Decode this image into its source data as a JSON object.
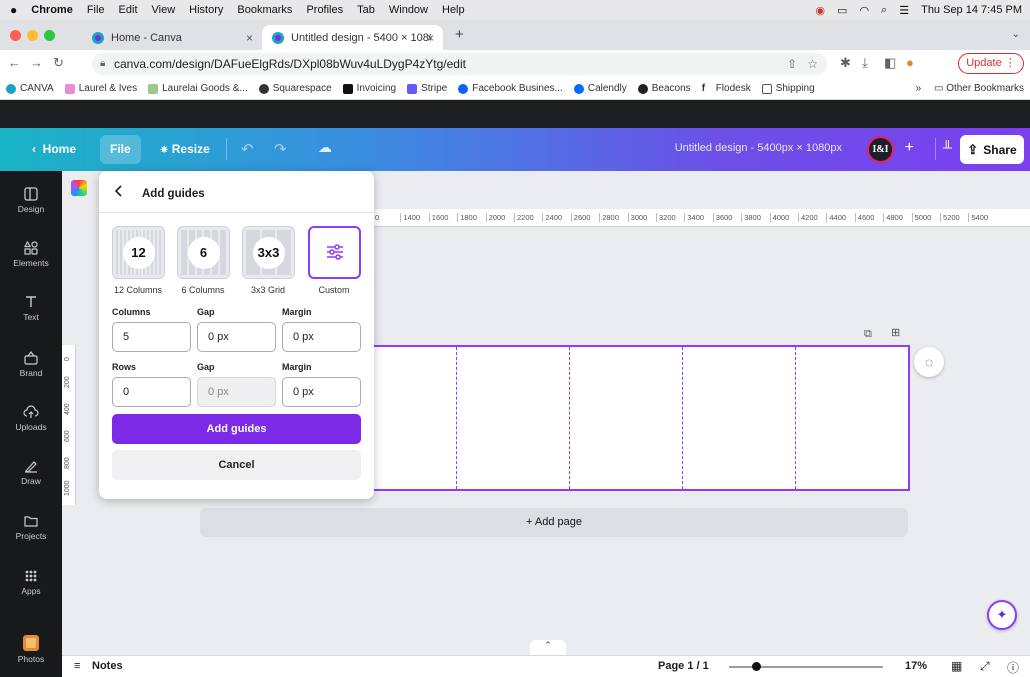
{
  "menubar": {
    "app": "Chrome",
    "items": [
      "File",
      "Edit",
      "View",
      "History",
      "Bookmarks",
      "Profiles",
      "Tab",
      "Window",
      "Help"
    ],
    "datetime": "Thu Sep 14  7:45 PM"
  },
  "tabs": [
    {
      "label": "Home - Canva",
      "close": "×"
    },
    {
      "label": "Untitled design - 5400 × 1080",
      "close": "×"
    }
  ],
  "new_tab": "+",
  "address": {
    "url": "canva.com/design/DAFueElgRds/DXpl08bWuv4uLDygP4zYtg/edit",
    "update_label": "Update"
  },
  "bookmarks": {
    "items": [
      "CANVA",
      "Laurel & Ives",
      "Laurelai Goods &...",
      "Squarespace",
      "Invoicing",
      "Stripe",
      "Facebook Busines...",
      "Calendly",
      "Beacons",
      "Flodesk",
      "Shipping"
    ],
    "more": "»",
    "other": "Other Bookmarks"
  },
  "header": {
    "home": "Home",
    "file": "File",
    "resize": "Resize",
    "title": "Untitled design - 5400px × 1080px",
    "avatar_text": "I&I",
    "share": "Share"
  },
  "sidebar": {
    "items": [
      "Design",
      "Elements",
      "Text",
      "Brand",
      "Uploads",
      "Draw",
      "Projects",
      "Apps",
      "Photos"
    ]
  },
  "panel": {
    "title": "Add guides",
    "presets": [
      {
        "badge": "12",
        "label": "12 Columns",
        "cols": 12
      },
      {
        "badge": "6",
        "label": "6 Columns",
        "cols": 6
      },
      {
        "badge": "3x3",
        "label": "3x3 Grid",
        "cols": 3
      },
      {
        "badge": "",
        "label": "Custom",
        "cols": 0
      }
    ],
    "labels": {
      "columns": "Columns",
      "gap": "Gap",
      "margin": "Margin",
      "rows": "Rows"
    },
    "columns_value": "5",
    "columns_gap": "0 px",
    "columns_margin": "0 px",
    "rows_value": "0",
    "rows_gap": "0 px",
    "rows_margin": "0 px",
    "add_label": "Add guides",
    "cancel_label": "Cancel"
  },
  "ruler": {
    "top_ticks": [
      "0",
      "1400",
      "1600",
      "1800",
      "2000",
      "2200",
      "2400",
      "2600",
      "2800",
      "3000",
      "3200",
      "3400",
      "3600",
      "3800",
      "4000",
      "4200",
      "4400",
      "4600",
      "4800",
      "5000",
      "5200",
      "5400"
    ],
    "left_ticks": [
      "0",
      "200",
      "400",
      "600",
      "800",
      "1000"
    ]
  },
  "canvas": {
    "add_page": "+ Add page",
    "guide_columns": 5
  },
  "bottom": {
    "notes": "Notes",
    "page": "Page 1 / 1",
    "zoom": "17%",
    "zoom_fraction": 0.15
  },
  "colors": {
    "accent": "#8b3dff",
    "button": "#7d2ae8",
    "sidebar": "#18191b"
  }
}
